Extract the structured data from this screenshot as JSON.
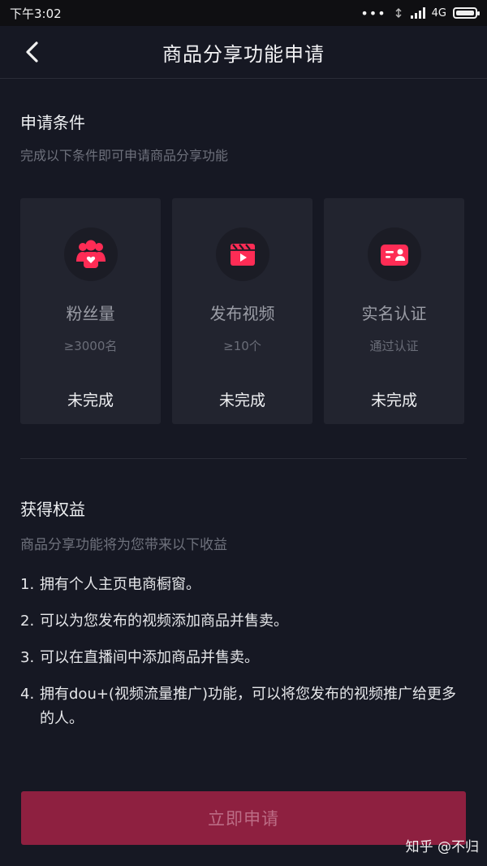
{
  "status": {
    "time": "下午3:02",
    "network": "4G"
  },
  "header": {
    "title": "商品分享功能申请"
  },
  "conditions": {
    "title": "申请条件",
    "subtitle": "完成以下条件即可申请商品分享功能",
    "cards": [
      {
        "label": "粉丝量",
        "requirement": "≥3000名",
        "status": "未完成",
        "icon": "fans-icon"
      },
      {
        "label": "发布视频",
        "requirement": "≥10个",
        "status": "未完成",
        "icon": "video-icon"
      },
      {
        "label": "实名认证",
        "requirement": "通过认证",
        "status": "未完成",
        "icon": "id-card-icon"
      }
    ]
  },
  "benefits": {
    "title": "获得权益",
    "subtitle": "商品分享功能将为您带来以下收益",
    "items": [
      {
        "num": "1.",
        "text": "拥有个人主页电商橱窗。"
      },
      {
        "num": "2.",
        "text": "可以为您发布的视频添加商品并售卖。"
      },
      {
        "num": "3.",
        "text": "可以在直播间中添加商品并售卖。"
      },
      {
        "num": "4.",
        "text": "拥有dou+(视频流量推广)功能，可以将您发布的视频推广给更多的人。"
      }
    ]
  },
  "button": {
    "label": "立即申请"
  },
  "watermark": "知乎 @不归",
  "colors": {
    "background": "#161823",
    "card": "#22242f",
    "accent": "#fe2c55",
    "button": "#8e2040"
  }
}
